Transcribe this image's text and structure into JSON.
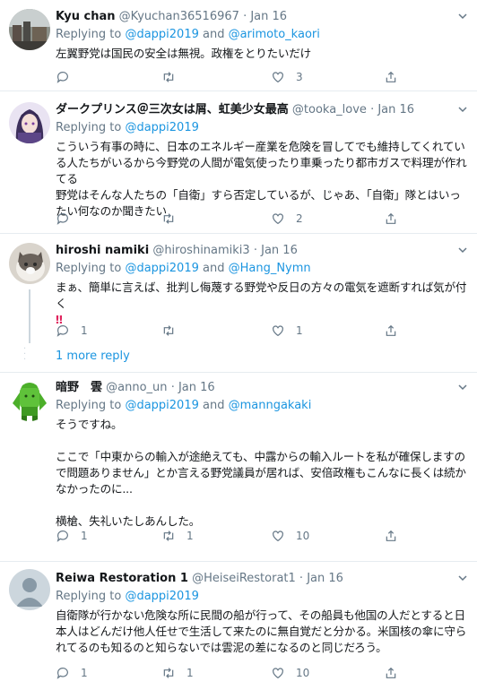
{
  "tweets": [
    {
      "name": "Kyu chan",
      "handle": "@Kyuchan36516967",
      "sep": "·",
      "date": "Jan 16",
      "replying_prefix": "Replying to ",
      "replying_1": "@dappi2019",
      "replying_and": " and ",
      "replying_2": "@arimoto_kaori",
      "text": "左翼野党は国民の安全は無視。政権をとりたいだけ",
      "reply_count": "",
      "retweet_count": "",
      "like_count": "3"
    },
    {
      "name": "ダークプリンス＠三次女は屑、虹美少女最高",
      "handle": "@tooka_love",
      "sep": "·",
      "date": "Jan 16",
      "replying_prefix": "Replying to ",
      "replying_1": "@dappi2019",
      "text": "こういう有事の時に、日本のエネルギー産業を危険を冒してでも維持してくれている人たちがいるから今野党の人間が電気使ったり車乗ったり都市ガスで料理が作れてる\n野党はそんな人たちの「自衛」すら否定しているが、じゃあ、「自衛」隊とはいったい何なのか聞きたい",
      "reply_count": "",
      "retweet_count": "",
      "like_count": "2"
    },
    {
      "name": "hiroshi namiki",
      "handle": "@hiroshinamiki3",
      "sep": "·",
      "date": "Jan 16",
      "replying_prefix": "Replying to ",
      "replying_1": "@dappi2019",
      "replying_and": " and ",
      "replying_2": "@Hang_Nymn",
      "text": "まぁ、簡単に言えば、批判し侮蔑する野党や反日の方々の電気を遮断すれば気が付く",
      "bang": "‼",
      "reply_count": "1",
      "retweet_count": "",
      "like_count": "1"
    },
    {
      "name": "暗野　雲",
      "handle": "@anno_un",
      "sep": "·",
      "date": "Jan 16",
      "replying_prefix": "Replying to ",
      "replying_1": "@dappi2019",
      "replying_and": " and ",
      "replying_2": "@manngakaki",
      "text": "そうですね。\n\nここで「中東からの輸入が途絶えても、中露からの輸入ルートを私が確保しますので問題ありません」とか言える野党議員が居れば、安倍政権もこんなに長くは続かなかったのに...\n\n横槍、失礼いたしあんした。",
      "reply_count": "1",
      "retweet_count": "1",
      "like_count": "10"
    },
    {
      "name": "Reiwa Restoration 1",
      "handle": "@HeiseiRestorat1",
      "sep": "·",
      "date": "Jan 16",
      "replying_prefix": "Replying to ",
      "replying_1": "@dappi2019",
      "text": "自衛隊が行かない危険な所に民間の船が行って、その船員も他国の人だとすると日本人はどんだけ他人任せで生活して来たのに無自覚だと分かる。米国核の傘に守られてるのも知るのと知らないでは雲泥の差になるのと同じだろう。",
      "reply_count": "1",
      "retweet_count": "1",
      "like_count": "10"
    }
  ],
  "more_reply": "1 more reply"
}
